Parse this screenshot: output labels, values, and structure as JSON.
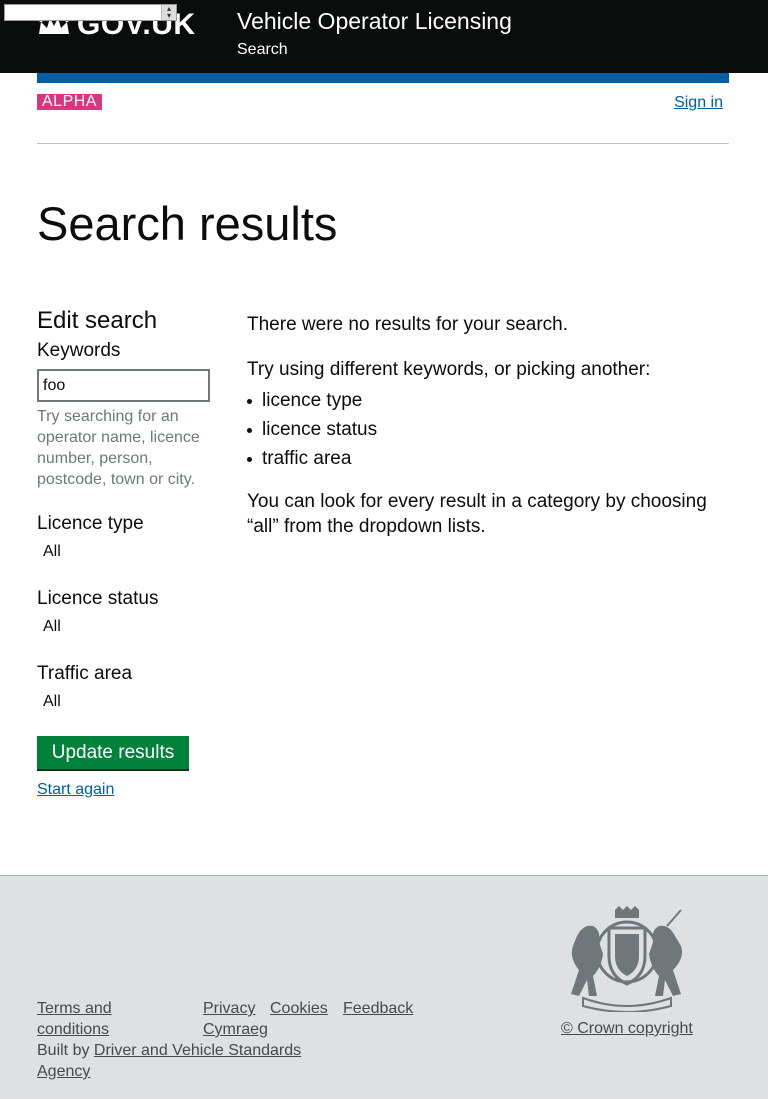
{
  "header": {
    "logo_text": "GOV.UK",
    "service_name": "Vehicle Operator Licensing",
    "nav_search": "Search"
  },
  "phase": {
    "tag": "ALPHA",
    "sign_in": "Sign in"
  },
  "page": {
    "title": "Search results"
  },
  "sidebar": {
    "heading": "Edit search",
    "keywords_label": "Keywords",
    "keywords_value": "foo",
    "keywords_hint": "Try searching for an operator name, licence number, person, postcode, town or city.",
    "licence_type_label": "Licence type",
    "licence_type_value": "All",
    "licence_status_label": "Licence status",
    "licence_status_value": "All",
    "traffic_area_label": "Traffic area",
    "traffic_area_value": "All",
    "update_button": "Update results",
    "start_again": "Start again"
  },
  "results": {
    "no_results": "There were no results for your search.",
    "try_text": "Try using different keywords, or picking another:",
    "options": [
      "licence type",
      "licence status",
      "traffic area"
    ],
    "all_text": "You can look for every result in a category by choosing “all” from the dropdown lists."
  },
  "footer": {
    "terms": "Terms and conditions",
    "privacy": "Privacy",
    "cookies": "Cookies",
    "feedback": "Feedback",
    "cymraeg": "Cymraeg",
    "built_by_prefix": "Built by ",
    "built_by_link": "Driver and Vehicle Standards Agency",
    "copyright": "© Crown copyright"
  },
  "colors": {
    "header_bg": "#0b0c0c",
    "brand_blue": "#005ea5",
    "alpha_pink": "#d53880",
    "button_green": "#00823b",
    "footer_bg": "#dee0e2"
  },
  "icons": {
    "crown": "crown-icon",
    "crest": "royal-coat-of-arms-icon",
    "select_arrows": "select-arrows-icon"
  }
}
